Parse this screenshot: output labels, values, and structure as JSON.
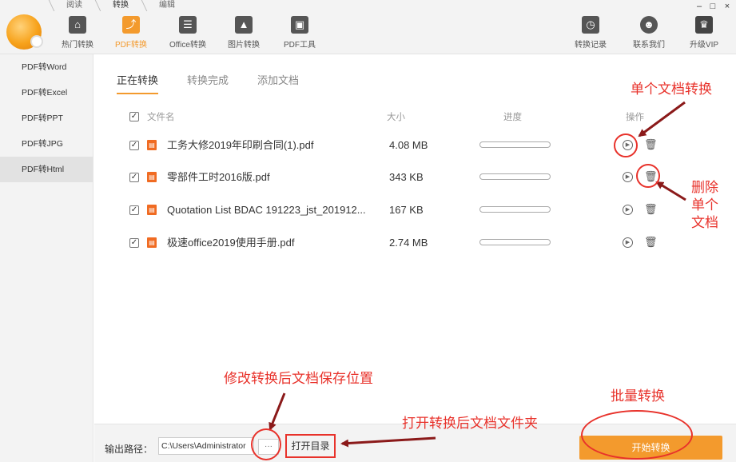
{
  "mode_tabs": [
    "阅读",
    "转换",
    "编辑"
  ],
  "toolbar": {
    "items": [
      {
        "label": "热门转换",
        "icon": "home-icon"
      },
      {
        "label": "PDF转换",
        "icon": "pdf-convert-icon"
      },
      {
        "label": "Office转换",
        "icon": "office-convert-icon"
      },
      {
        "label": "图片转换",
        "icon": "image-convert-icon"
      },
      {
        "label": "PDF工具",
        "icon": "toolbox-icon"
      }
    ],
    "right_items": [
      {
        "label": "转换记录",
        "icon": "history-icon"
      },
      {
        "label": "联系我们",
        "icon": "support-icon"
      },
      {
        "label": "升级VIP",
        "icon": "crown-icon"
      }
    ]
  },
  "window": {
    "minimize": "–",
    "maximize": "□",
    "close": "×"
  },
  "sidebar": {
    "items": [
      {
        "label": "PDF转Word"
      },
      {
        "label": "PDF转Excel"
      },
      {
        "label": "PDF转PPT"
      },
      {
        "label": "PDF转JPG"
      },
      {
        "label": "PDF转Html"
      }
    ],
    "active_index": 4
  },
  "subtabs": [
    {
      "label": "正在转换",
      "active": true
    },
    {
      "label": "转换完成",
      "active": false
    },
    {
      "label": "添加文档",
      "active": false
    }
  ],
  "table": {
    "headers": {
      "name": "文件名",
      "size": "大小",
      "progress": "进度",
      "action": "操作"
    },
    "rows": [
      {
        "name": "工务大修2019年印刷合同(1).pdf",
        "size": "4.08 MB",
        "progress": 0
      },
      {
        "name": "零部件工时2016版.pdf",
        "size": "343 KB",
        "progress": 0
      },
      {
        "name": "Quotation List BDAC 191223_jst_201912...",
        "size": "167 KB",
        "progress": 0
      },
      {
        "name": "极速office2019使用手册.pdf",
        "size": "2.74 MB",
        "progress": 0
      }
    ]
  },
  "bottom": {
    "output_label": "输出路径：",
    "output_path": "C:\\Users\\Administrator",
    "browse_label": "···",
    "open_dir_label": "打开目录",
    "start_label": "开始转换"
  },
  "annotations": {
    "single_convert": "单个文档转换",
    "delete_single": [
      "删除",
      "单个",
      "文档"
    ],
    "change_save_location": "修改转换后文档保存位置",
    "open_folder": "打开转换后文档文件夹",
    "batch_convert": "批量转换"
  },
  "colors": {
    "accent": "#f39a2d",
    "annotation": "#e8322b"
  }
}
